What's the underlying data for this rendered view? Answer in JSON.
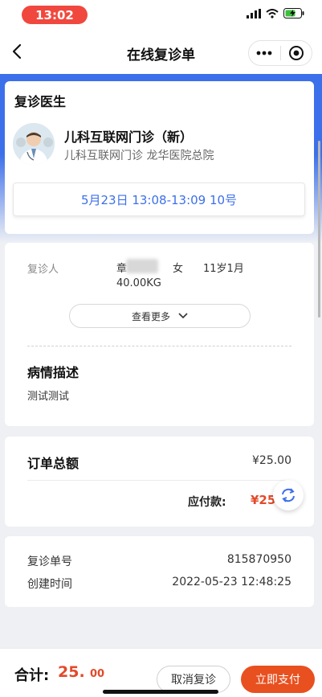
{
  "status_bar": {
    "time": "13:02",
    "icons": [
      "signal-icon",
      "wifi-icon",
      "battery-charging-icon"
    ]
  },
  "nav": {
    "title": "在线复诊单",
    "more_icon": "more-dots-icon",
    "close_icon": "target-close-icon"
  },
  "doctor_card": {
    "title": "复诊医生",
    "doctor_name": "儿科互联网门诊（新）",
    "hospital": "儿科互联网门诊 龙华医院总院",
    "slot": "5月23日 13:08-13:09 10号"
  },
  "patient_card": {
    "label": "复诊人",
    "name_visible": "章",
    "gender": "女",
    "age": "11岁1月",
    "weight": "40.00KG",
    "more_label": "查看更多",
    "desc_title": "病情描述",
    "desc_text": "测试测试"
  },
  "amount_card": {
    "total_label": "订单总额",
    "total_value": "¥25.00",
    "pay_label": "应付款:",
    "pay_value": "¥25."
  },
  "order_card": {
    "rows": [
      {
        "key": "复诊单号",
        "value": "815870950"
      },
      {
        "key": "创建时间",
        "value": "2022-05-23 12:48:25"
      }
    ]
  },
  "bottom_bar": {
    "total_label": "合计:",
    "total_int": "25.",
    "total_dec": "00",
    "cancel_label": "取消复诊",
    "pay_label": "立即支付"
  },
  "colors": {
    "brand_blue": "#3c6fea",
    "price_red": "#e24a2a",
    "pay_orange": "#e8501f",
    "status_red": "#f0483e"
  }
}
